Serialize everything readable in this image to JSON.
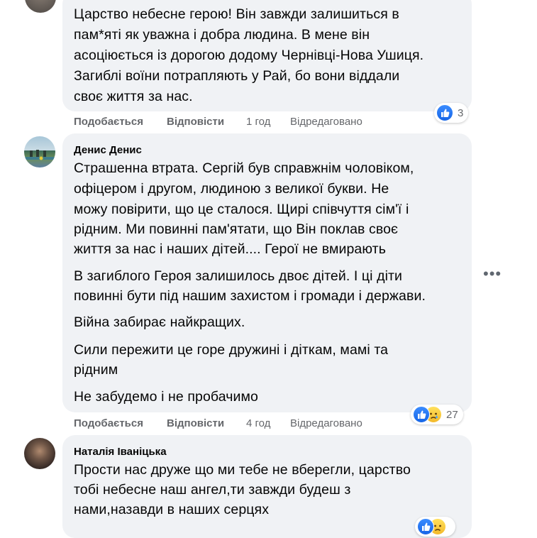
{
  "comments": [
    {
      "author": "",
      "paragraphs": [
        "Царство небесне герою! Він завжди залишиться в",
        "пам*яті як уважна і добра людина. В мене він",
        "асоціюється із дорогою додому Чернівці-Нова Ушиця.",
        "Загиблі воїни потрапляють у Рай, бо вони віддали",
        "своє життя за нас."
      ],
      "actions": {
        "like": "Подобається",
        "reply": "Відповісти",
        "time": "1 год",
        "edited": "Відредаговано"
      },
      "reactions": {
        "types": [
          "like-icon"
        ],
        "count": "3"
      }
    },
    {
      "author": "Денис Денис",
      "paragraphs": [
        "Страшенна втрата. Сергій був справжнім чоловіком,",
        "офіцером і другом, людиною з великої букви. Не",
        "можу повірити, що це сталося. Щирі співчуття сім'ї і",
        "рідним. Ми повинні пам'ятати, що Він поклав своє",
        "життя за нас і наших дітей.... Герої не вмирають",
        "В загиблого Героя залишилось двоє дітей. І ці діти",
        "повинні бути під нашим захистом і громади і держави.",
        "Війна забирає найкращих.",
        "Сили пережити це горе дружині і діткам, мамі та",
        "рідним",
        "Не забудемо і не пробачимо"
      ],
      "actions": {
        "like": "Подобається",
        "reply": "Відповісти",
        "time": "4 год",
        "edited": "Відредаговано"
      },
      "reactions": {
        "types": [
          "like-icon",
          "sad-icon"
        ],
        "count": "27"
      },
      "more_label": "•••"
    },
    {
      "author": "Наталія Іваніцька",
      "paragraphs": [
        "Прости нас друже що ми тебе не вберегли, царство",
        "тобі небесне наш ангел,ти завжди будеш з",
        "нами,назавди в наших серцях"
      ],
      "reactions": {
        "types": [
          "like-icon",
          "sad-icon"
        ],
        "count": ""
      }
    }
  ],
  "colors": {
    "bubble": "#f0f2f5",
    "meta_text": "#65676b",
    "like_blue": "#1877f2",
    "sad_yellow": "#f7c94b"
  }
}
